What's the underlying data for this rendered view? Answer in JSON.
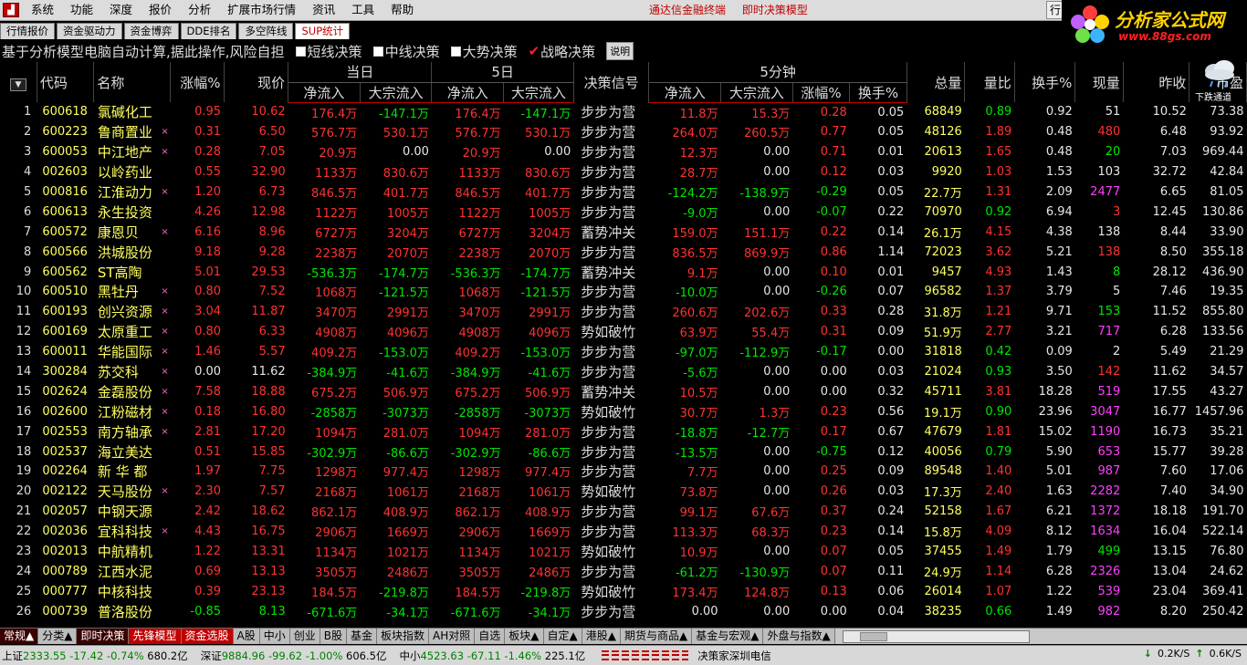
{
  "menu": [
    "系统",
    "功能",
    "深度",
    "报价",
    "分析",
    "扩展市场行情",
    "资讯",
    "工具",
    "帮助"
  ],
  "title_links": [
    "通达信金融终端",
    "即时决策模型"
  ],
  "window_btn": "行",
  "brand": {
    "name": "分析家公式网",
    "url": "www.88gs.com"
  },
  "weather_text": "下跌通道",
  "tabs": [
    "行情报价",
    "资金驱动力",
    "资金博弈",
    "DDE排名",
    "多空阵线",
    "SUP统计"
  ],
  "active_tab": 5,
  "info_text": "基于分析模型电脑自动计算,据此操作,风险自担",
  "options": [
    {
      "label": "短线决策",
      "checked": false
    },
    {
      "label": "中线决策",
      "checked": false
    },
    {
      "label": "大势决策",
      "checked": false
    },
    {
      "label": "战略决策",
      "checked": true
    }
  ],
  "explain_btn": "说明",
  "header": {
    "group_today": "当日",
    "group_5day": "5日",
    "group_5min": "5分钟",
    "code": "代码",
    "name": "名称",
    "change": "涨幅%",
    "price": "现价",
    "net_inflow": "净流入",
    "big_inflow": "大宗流入",
    "signal": "决策信号",
    "turnover": "换手%",
    "total_vol": "总量",
    "vol_ratio": "量比",
    "cur_vol": "现量",
    "prev_close": "昨收",
    "pe": "市盈"
  },
  "rows": [
    [
      "1",
      "600618",
      "氯碱化工",
      "",
      "0.95",
      "10.62",
      "176.4万",
      "-147.1万",
      "176.4万",
      "-147.1万",
      "步步为营",
      "11.8万",
      "15.3万",
      "0.28",
      "0.05",
      "68849",
      "0.89",
      "0.92",
      "51",
      "10.52",
      "73.38"
    ],
    [
      "2",
      "600223",
      "鲁商置业",
      "×",
      "0.31",
      "6.50",
      "576.7万",
      "530.1万",
      "576.7万",
      "530.1万",
      "步步为营",
      "264.0万",
      "260.5万",
      "0.77",
      "0.05",
      "48126",
      "1.89",
      "0.48",
      "480",
      "6.48",
      "93.92"
    ],
    [
      "3",
      "600053",
      "中江地产",
      "×",
      "0.28",
      "7.05",
      "20.9万",
      "0.00",
      "20.9万",
      "0.00",
      "步步为营",
      "12.3万",
      "0.00",
      "0.71",
      "0.01",
      "20613",
      "1.65",
      "0.48",
      "20",
      "7.03",
      "969.44"
    ],
    [
      "4",
      "002603",
      "以岭药业",
      "",
      "0.55",
      "32.90",
      "1133万",
      "830.6万",
      "1133万",
      "830.6万",
      "步步为营",
      "28.7万",
      "0.00",
      "0.12",
      "0.03",
      "9920",
      "1.03",
      "1.53",
      "103",
      "32.72",
      "42.84"
    ],
    [
      "5",
      "000816",
      "江淮动力",
      "×",
      "1.20",
      "6.73",
      "846.5万",
      "401.7万",
      "846.5万",
      "401.7万",
      "步步为营",
      "-124.2万",
      "-138.9万",
      "-0.29",
      "0.05",
      "22.7万",
      "1.31",
      "2.09",
      "2477",
      "6.65",
      "81.05"
    ],
    [
      "6",
      "600613",
      "永生投资",
      "",
      "4.26",
      "12.98",
      "1122万",
      "1005万",
      "1122万",
      "1005万",
      "步步为营",
      "-9.0万",
      "0.00",
      "-0.07",
      "0.22",
      "70970",
      "0.92",
      "6.94",
      "3",
      "12.45",
      "130.86"
    ],
    [
      "7",
      "600572",
      "康恩贝",
      "×",
      "6.16",
      "8.96",
      "6727万",
      "3204万",
      "6727万",
      "3204万",
      "蓄势冲关",
      "159.0万",
      "151.1万",
      "0.22",
      "0.14",
      "26.1万",
      "4.15",
      "4.38",
      "138",
      "8.44",
      "33.90"
    ],
    [
      "8",
      "600566",
      "洪城股份",
      "",
      "9.18",
      "9.28",
      "2238万",
      "2070万",
      "2238万",
      "2070万",
      "步步为营",
      "836.5万",
      "869.9万",
      "0.86",
      "1.14",
      "72023",
      "3.62",
      "5.21",
      "138",
      "8.50",
      "355.18"
    ],
    [
      "9",
      "600562",
      "ST高陶",
      "",
      "5.01",
      "29.53",
      "-536.3万",
      "-174.7万",
      "-536.3万",
      "-174.7万",
      "蓄势冲关",
      "9.1万",
      "0.00",
      "0.10",
      "0.01",
      "9457",
      "4.93",
      "1.43",
      "8",
      "28.12",
      "436.90"
    ],
    [
      "10",
      "600510",
      "黑牡丹",
      "×",
      "0.80",
      "7.52",
      "1068万",
      "-121.5万",
      "1068万",
      "-121.5万",
      "步步为营",
      "-10.0万",
      "0.00",
      "-0.26",
      "0.07",
      "96582",
      "1.37",
      "3.79",
      "5",
      "7.46",
      "19.35"
    ],
    [
      "11",
      "600193",
      "创兴资源",
      "×",
      "3.04",
      "11.87",
      "3470万",
      "2991万",
      "3470万",
      "2991万",
      "步步为营",
      "260.6万",
      "202.6万",
      "0.33",
      "0.28",
      "31.8万",
      "1.21",
      "9.71",
      "153",
      "11.52",
      "855.80"
    ],
    [
      "12",
      "600169",
      "太原重工",
      "×",
      "0.80",
      "6.33",
      "4908万",
      "4096万",
      "4908万",
      "4096万",
      "势如破竹",
      "63.9万",
      "55.4万",
      "0.31",
      "0.09",
      "51.9万",
      "2.77",
      "3.21",
      "717",
      "6.28",
      "133.56"
    ],
    [
      "13",
      "600011",
      "华能国际",
      "×",
      "1.46",
      "5.57",
      "409.2万",
      "-153.0万",
      "409.2万",
      "-153.0万",
      "步步为营",
      "-97.0万",
      "-112.9万",
      "-0.17",
      "0.00",
      "31818",
      "0.42",
      "0.09",
      "2",
      "5.49",
      "21.29"
    ],
    [
      "14",
      "300284",
      "苏交科",
      "×",
      "0.00",
      "11.62",
      "-384.9万",
      "-41.6万",
      "-384.9万",
      "-41.6万",
      "步步为营",
      "-5.6万",
      "0.00",
      "0.00",
      "0.03",
      "21024",
      "0.93",
      "3.50",
      "142",
      "11.62",
      "34.57"
    ],
    [
      "15",
      "002624",
      "金磊股份",
      "×",
      "7.58",
      "18.88",
      "675.2万",
      "506.9万",
      "675.2万",
      "506.9万",
      "蓄势冲关",
      "10.5万",
      "0.00",
      "0.00",
      "0.32",
      "45711",
      "3.81",
      "18.28",
      "519",
      "17.55",
      "43.27"
    ],
    [
      "16",
      "002600",
      "江粉磁材",
      "×",
      "0.18",
      "16.80",
      "-2858万",
      "-3073万",
      "-2858万",
      "-3073万",
      "势如破竹",
      "30.7万",
      "1.3万",
      "0.23",
      "0.56",
      "19.1万",
      "0.90",
      "23.96",
      "3047",
      "16.77",
      "1457.96"
    ],
    [
      "17",
      "002553",
      "南方轴承",
      "×",
      "2.81",
      "17.20",
      "1094万",
      "281.0万",
      "1094万",
      "281.0万",
      "步步为营",
      "-18.8万",
      "-12.7万",
      "0.17",
      "0.67",
      "47679",
      "1.81",
      "15.02",
      "1190",
      "16.73",
      "35.21"
    ],
    [
      "18",
      "002537",
      "海立美达",
      "",
      "0.51",
      "15.85",
      "-302.9万",
      "-86.6万",
      "-302.9万",
      "-86.6万",
      "步步为营",
      "-13.5万",
      "0.00",
      "-0.75",
      "0.12",
      "40056",
      "0.79",
      "5.90",
      "653",
      "15.77",
      "39.28"
    ],
    [
      "19",
      "002264",
      "新 华 都",
      "",
      "1.97",
      "7.75",
      "1298万",
      "977.4万",
      "1298万",
      "977.4万",
      "步步为营",
      "7.7万",
      "0.00",
      "0.25",
      "0.09",
      "89548",
      "1.40",
      "5.01",
      "987",
      "7.60",
      "17.06"
    ],
    [
      "20",
      "002122",
      "天马股份",
      "×",
      "2.30",
      "7.57",
      "2168万",
      "1061万",
      "2168万",
      "1061万",
      "势如破竹",
      "73.8万",
      "0.00",
      "0.26",
      "0.03",
      "17.3万",
      "2.40",
      "1.63",
      "2282",
      "7.40",
      "34.90"
    ],
    [
      "21",
      "002057",
      "中钢天源",
      "",
      "2.42",
      "18.62",
      "862.1万",
      "408.9万",
      "862.1万",
      "408.9万",
      "步步为营",
      "99.1万",
      "67.6万",
      "0.37",
      "0.24",
      "52158",
      "1.67",
      "6.21",
      "1372",
      "18.18",
      "191.70"
    ],
    [
      "22",
      "002036",
      "宜科科技",
      "×",
      "4.43",
      "16.75",
      "2906万",
      "1669万",
      "2906万",
      "1669万",
      "步步为营",
      "113.3万",
      "68.3万",
      "0.23",
      "0.14",
      "15.8万",
      "4.09",
      "8.12",
      "1634",
      "16.04",
      "522.14"
    ],
    [
      "23",
      "002013",
      "中航精机",
      "",
      "1.22",
      "13.31",
      "1134万",
      "1021万",
      "1134万",
      "1021万",
      "势如破竹",
      "10.9万",
      "0.00",
      "0.07",
      "0.05",
      "37455",
      "1.49",
      "1.79",
      "499",
      "13.15",
      "76.80"
    ],
    [
      "24",
      "000789",
      "江西水泥",
      "",
      "0.69",
      "13.13",
      "3505万",
      "2486万",
      "3505万",
      "2486万",
      "步步为营",
      "-61.2万",
      "-130.9万",
      "0.07",
      "0.11",
      "24.9万",
      "1.14",
      "6.28",
      "2326",
      "13.04",
      "24.62"
    ],
    [
      "25",
      "000777",
      "中核科技",
      "",
      "0.39",
      "23.13",
      "184.5万",
      "-219.8万",
      "184.5万",
      "-219.8万",
      "势如破竹",
      "173.4万",
      "124.8万",
      "0.13",
      "0.06",
      "26014",
      "1.07",
      "1.22",
      "539",
      "23.04",
      "369.41"
    ],
    [
      "26",
      "000739",
      "普洛股份",
      "",
      "-0.85",
      "8.13",
      "-671.6万",
      "-34.1万",
      "-671.6万",
      "-34.1万",
      "步步为营",
      "0.00",
      "0.00",
      "0.00",
      "0.04",
      "38235",
      "0.66",
      "1.49",
      "982",
      "8.20",
      "250.42"
    ]
  ],
  "bottom_tabs": [
    {
      "label": "常规▲",
      "style": "dark"
    },
    {
      "label": "分类▲",
      "style": ""
    },
    {
      "label": "即时决策",
      "style": "dark"
    },
    {
      "label": "先锋模型",
      "style": "red"
    },
    {
      "label": "资金选股",
      "style": "red"
    },
    {
      "label": "A股",
      "style": ""
    },
    {
      "label": "中小",
      "style": ""
    },
    {
      "label": "创业",
      "style": ""
    },
    {
      "label": "B股",
      "style": ""
    },
    {
      "label": "基金",
      "style": ""
    },
    {
      "label": "板块指数",
      "style": ""
    },
    {
      "label": "AH对照",
      "style": ""
    },
    {
      "label": "自选",
      "style": ""
    },
    {
      "label": "板块▲",
      "style": ""
    },
    {
      "label": "自定▲",
      "style": ""
    },
    {
      "label": "港股▲",
      "style": ""
    },
    {
      "label": "期货与商品▲",
      "style": ""
    },
    {
      "label": "基金与宏观▲",
      "style": ""
    },
    {
      "label": "外盘与指数▲",
      "style": ""
    }
  ],
  "status": {
    "sh_name": "上证",
    "sh_value": "2333.55",
    "sh_chg": "-17.42",
    "sh_pct": "-0.74%",
    "sh_amt": "680.2亿",
    "sz_name": "深证",
    "sz_value": "9884.96",
    "sz_chg": "-99.62",
    "sz_pct": "-1.00%",
    "sz_amt": "606.5亿",
    "zx_name": "中小",
    "zx_value": "4523.63",
    "zx_chg": "-67.11",
    "zx_pct": "-1.46%",
    "zx_amt": "225.1亿",
    "ticker": "决策家深圳电信",
    "net_down": "0.2K/S",
    "net_up": "0.6K/S"
  },
  "colors": {
    "up": "#ff3232",
    "down": "#00e600",
    "stock_name": "#ffff60",
    "accent": "#c00000"
  }
}
